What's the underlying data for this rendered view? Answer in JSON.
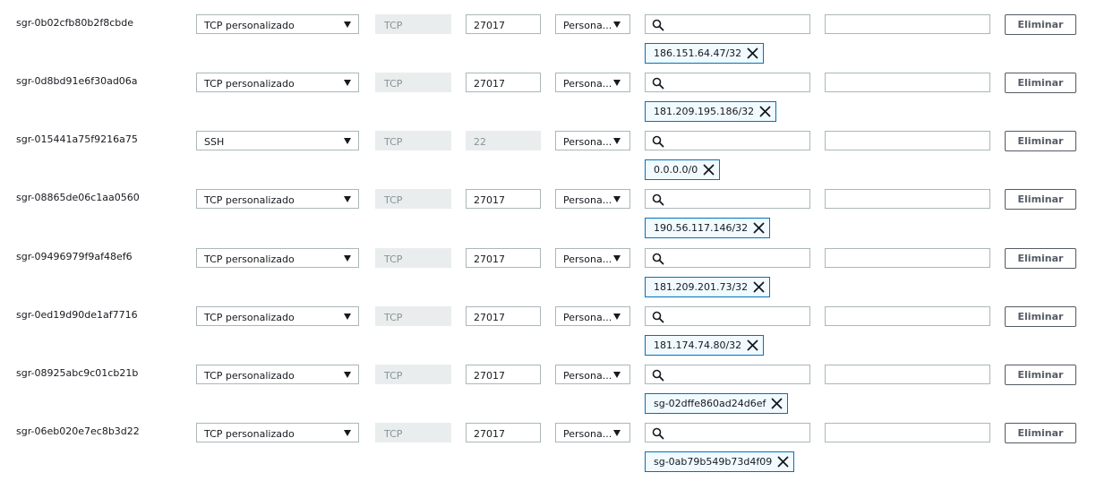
{
  "rules": [
    {
      "id": "sgr-0b02cfb80b2f8cbde",
      "type": "TCP personalizado",
      "protocol": "TCP",
      "port": "27017",
      "port_editable": true,
      "source_type": "Persona...",
      "source_value": "186.151.64.47/32",
      "delete_label": "Eliminar"
    },
    {
      "id": "sgr-0d8bd91e6f30ad06a",
      "type": "TCP personalizado",
      "protocol": "TCP",
      "port": "27017",
      "port_editable": true,
      "source_type": "Persona...",
      "source_value": "181.209.195.186/32",
      "delete_label": "Eliminar"
    },
    {
      "id": "sgr-015441a75f9216a75",
      "type": "SSH",
      "protocol": "TCP",
      "port": "22",
      "port_editable": false,
      "source_type": "Persona...",
      "source_value": "0.0.0.0/0",
      "delete_label": "Eliminar"
    },
    {
      "id": "sgr-08865de06c1aa0560",
      "type": "TCP personalizado",
      "protocol": "TCP",
      "port": "27017",
      "port_editable": true,
      "source_type": "Persona...",
      "source_value": "190.56.117.146/32",
      "delete_label": "Eliminar"
    },
    {
      "id": "sgr-09496979f9af48ef6",
      "type": "TCP personalizado",
      "protocol": "TCP",
      "port": "27017",
      "port_editable": true,
      "source_type": "Persona...",
      "source_value": "181.209.201.73/32",
      "delete_label": "Eliminar"
    },
    {
      "id": "sgr-0ed19d90de1af7716",
      "type": "TCP personalizado",
      "protocol": "TCP",
      "port": "27017",
      "port_editable": true,
      "source_type": "Persona...",
      "source_value": "181.174.74.80/32",
      "delete_label": "Eliminar"
    },
    {
      "id": "sgr-08925abc9c01cb21b",
      "type": "TCP personalizado",
      "protocol": "TCP",
      "port": "27017",
      "port_editable": true,
      "source_type": "Persona...",
      "source_value": "sg-02dffe860ad24d6ef",
      "delete_label": "Eliminar"
    },
    {
      "id": "sgr-06eb020e7ec8b3d22",
      "type": "TCP personalizado",
      "protocol": "TCP",
      "port": "27017",
      "port_editable": true,
      "source_type": "Persona...",
      "source_value": "sg-0ab79b549b73d4f09",
      "delete_label": "Eliminar"
    }
  ],
  "icons": {
    "dropdown": "caret-down-icon",
    "search": "search-icon",
    "remove": "close-icon"
  },
  "colors": {
    "token_border": "#0073bb",
    "token_background": "#f1faff",
    "input_border": "#aab7b8",
    "disabled_background": "#eaeded",
    "button_border": "#545b64"
  }
}
